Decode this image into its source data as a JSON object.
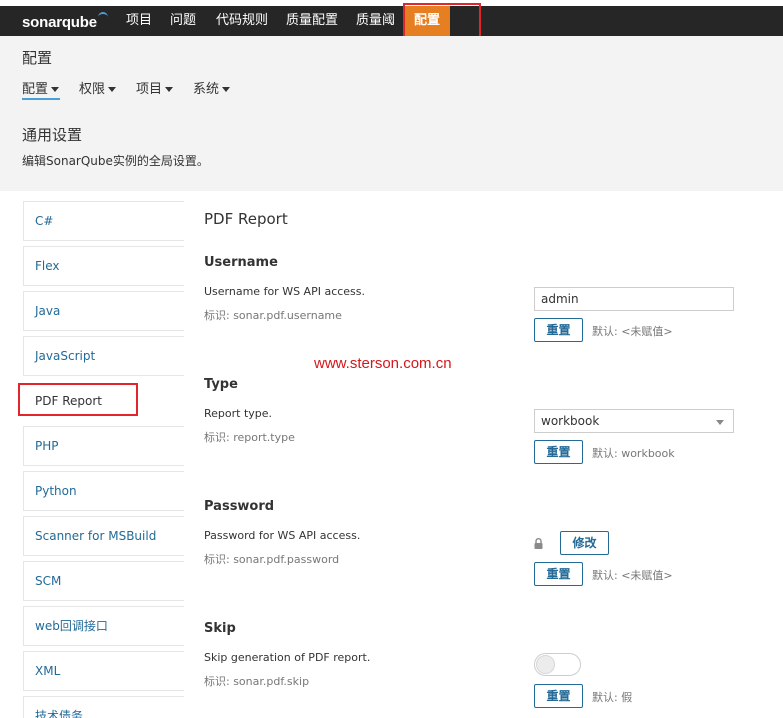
{
  "topbar": {
    "logo": "sonarqube",
    "nav": [
      "项目",
      "问题",
      "代码规则",
      "质量配置",
      "质量阈",
      "配置"
    ],
    "active_nav": "配置"
  },
  "page": {
    "title": "配置",
    "subnav": [
      "配置",
      "权限",
      "项目",
      "系统"
    ],
    "settings_title": "通用设置",
    "settings_desc": "编辑SonarQube实例的全局设置。"
  },
  "categories": [
    "C#",
    "Flex",
    "Java",
    "JavaScript",
    "PDF Report",
    "PHP",
    "Python",
    "Scanner for MSBuild",
    "SCM",
    "web回调接口",
    "XML",
    "技术债务"
  ],
  "selected_category": "PDF Report",
  "panel": {
    "title": "PDF Report",
    "definitions": [
      {
        "title": "Username",
        "description": "Username for WS API access.",
        "key": "标识: sonar.pdf.username",
        "control": "text",
        "value": "admin",
        "reset_label": "重置",
        "default_text": "默认: <未赋值>"
      },
      {
        "title": "Type",
        "description": "Report type.",
        "key": "标识: report.type",
        "control": "select",
        "value": "workbook",
        "reset_label": "重置",
        "default_text": "默认: workbook"
      },
      {
        "title": "Password",
        "description": "Password for WS API access.",
        "key": "标识: sonar.pdf.password",
        "control": "password",
        "change_label": "修改",
        "reset_label": "重置",
        "default_text": "默认: <未赋值>"
      },
      {
        "title": "Skip",
        "description": "Skip generation of PDF report.",
        "key": "标识: sonar.pdf.skip",
        "control": "toggle",
        "value": false,
        "reset_label": "重置",
        "default_text": "默认: 假"
      }
    ]
  },
  "watermark": "www.sterson.com.cn",
  "colors": {
    "topbar_bg": "#262626",
    "active_nav_bg": "#e67e22",
    "link_blue": "#236a97",
    "highlight_red": "#e0262a"
  }
}
